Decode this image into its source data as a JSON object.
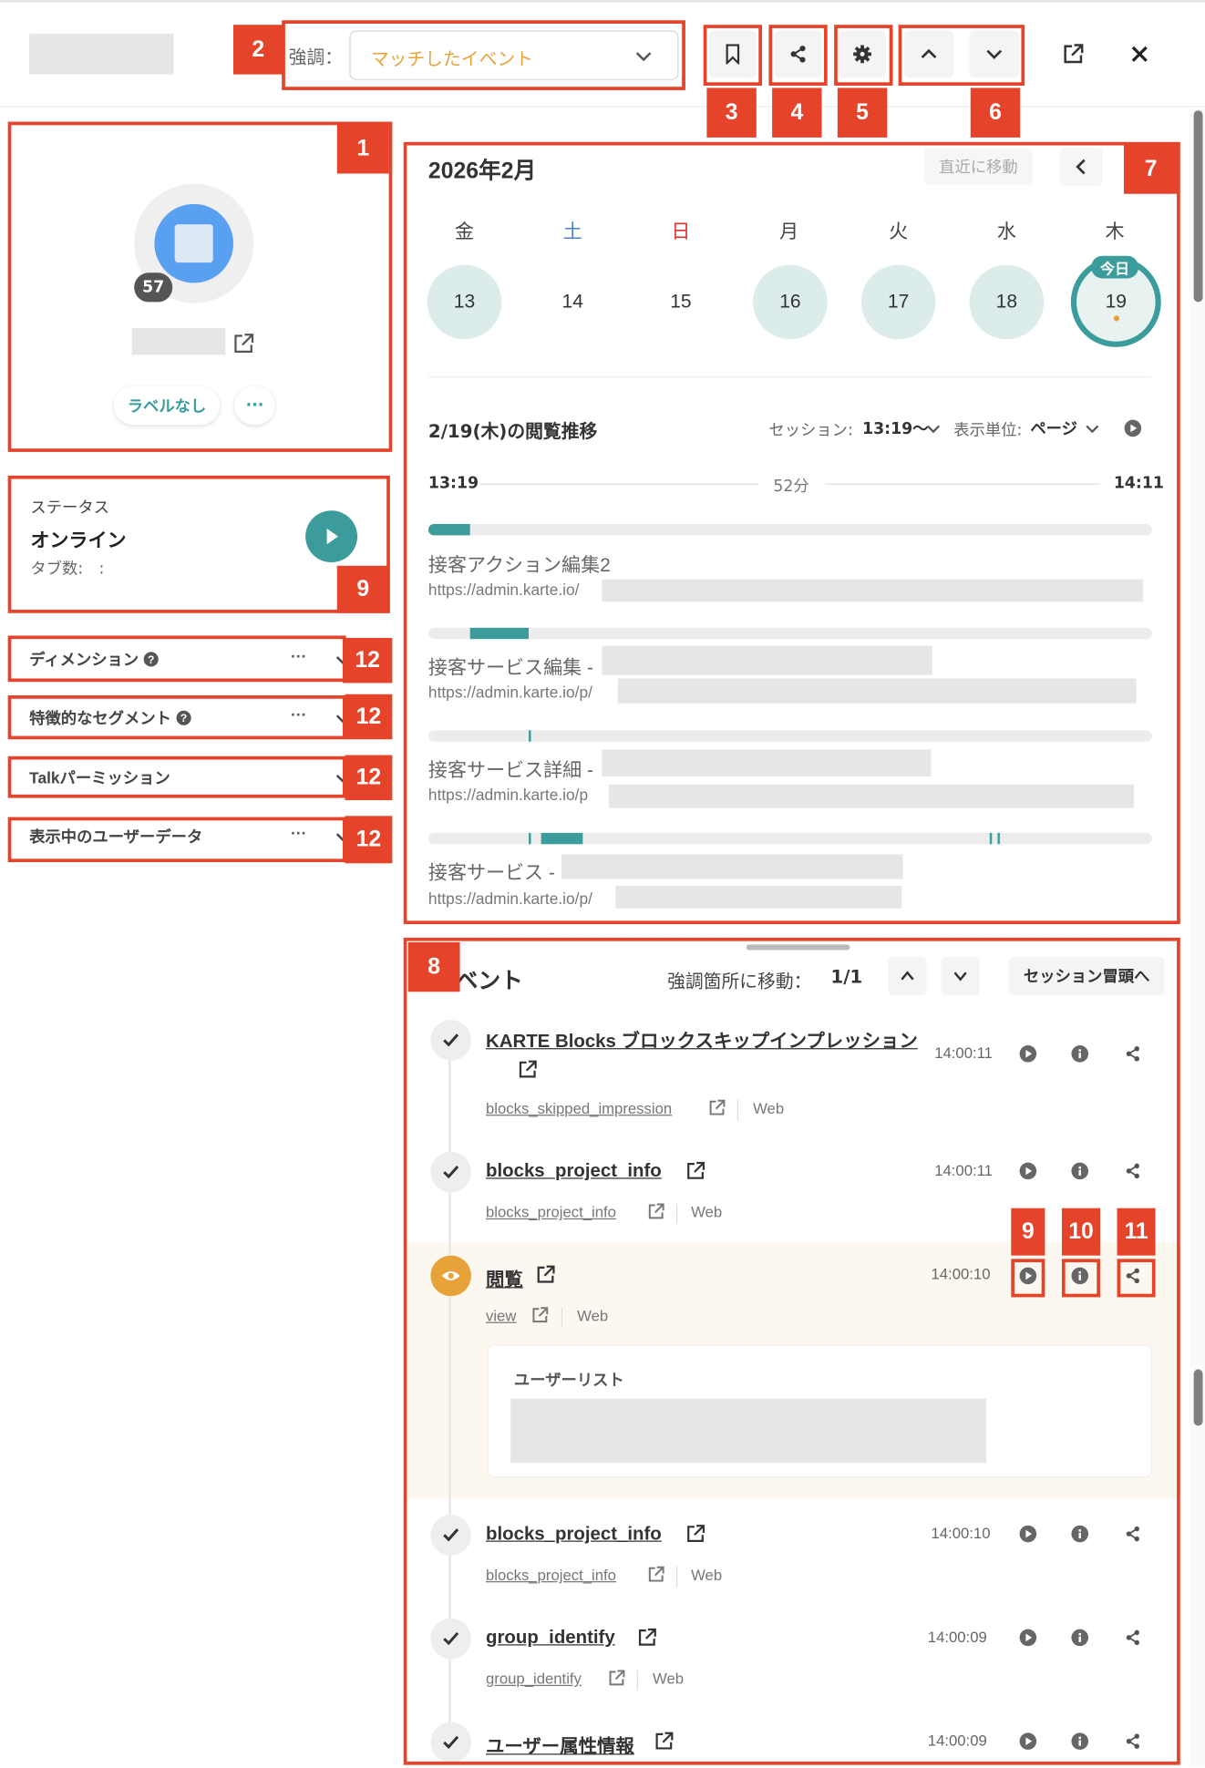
{
  "header": {
    "highlight_label": "強調：",
    "highlight_value": "マッチしたイベント"
  },
  "profile": {
    "visit_count": "57",
    "label_button": "ラベルなし",
    "more_button": "···"
  },
  "status": {
    "title": "ステータス",
    "value": "オンライン",
    "tabs_label": "タブ数:　:"
  },
  "sections": [
    {
      "label": "ディメンション",
      "more": "···"
    },
    {
      "label": "特徴的なセグメント",
      "more": "···"
    },
    {
      "label": "Talkパーミッション"
    },
    {
      "label": "表示中のユーザーデータ",
      "more": "···"
    }
  ],
  "calendar": {
    "month": "2026年2月",
    "jump_recent": "直近に移動",
    "weekdays": [
      "金",
      "土",
      "日",
      "月",
      "火",
      "水",
      "木"
    ],
    "days": [
      "13",
      "14",
      "15",
      "16",
      "17",
      "18",
      "19"
    ],
    "today_label": "今日"
  },
  "browsing": {
    "title": "2/19(木)の閲覧推移",
    "session_label": "セッション:",
    "session_value": "13:19〜",
    "unit_label": "表示単位:",
    "unit_value": "ページ",
    "start_time": "13:19",
    "duration": "52分",
    "end_time": "14:11",
    "pages": [
      {
        "title": "接客アクション編集2",
        "url": "https://admin.karte.io/"
      },
      {
        "title": "接客サービス編集 -",
        "url": "https://admin.karte.io/p/"
      },
      {
        "title": "接客サービス詳細 -",
        "url": "https://admin.karte.io/p"
      },
      {
        "title": "接客サービス -",
        "url": "https://admin.karte.io/p/"
      }
    ]
  },
  "events": {
    "title_fragment": "ベント",
    "jump_label": "強調箇所に移動：",
    "jump_count": "1/1",
    "session_start": "セッション冒頭へ",
    "items": [
      {
        "title": "KARTE Blocks ブロックスキップインプレッション",
        "time": "14:00:11",
        "event_name": "blocks_skipped_impression",
        "channel": "Web"
      },
      {
        "title": "blocks_project_info",
        "time": "14:00:11",
        "event_name": "blocks_project_info",
        "channel": "Web"
      },
      {
        "title": "閲覧",
        "time": "14:00:10",
        "event_name": "view",
        "channel": "Web",
        "detail_label": "ユーザーリスト"
      },
      {
        "title": "blocks_project_info",
        "time": "14:00:10",
        "event_name": "blocks_project_info",
        "channel": "Web"
      },
      {
        "title": "group_identify",
        "time": "14:00:09",
        "event_name": "group_identify",
        "channel": "Web"
      },
      {
        "title": "ユーザー属性情報",
        "time": "14:00:09"
      }
    ]
  },
  "annotations": [
    "1",
    "2",
    "3",
    "4",
    "5",
    "6",
    "7",
    "8",
    "9",
    "10",
    "11",
    "12"
  ],
  "colors": {
    "annotation": "#e5432a",
    "teal": "#3c9c9c",
    "orange": "#e8a23a",
    "blue": "#4a90e2"
  }
}
